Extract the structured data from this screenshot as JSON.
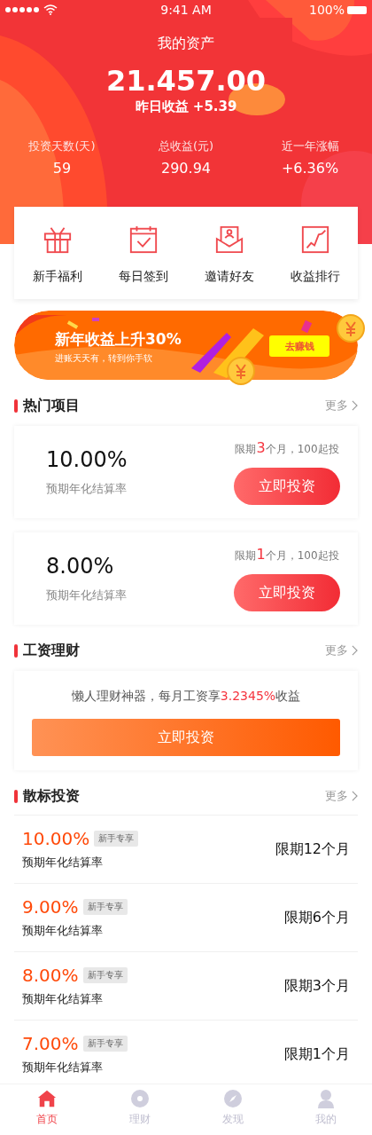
{
  "status_bar": {
    "time": "9:41 AM",
    "battery": "100%"
  },
  "header": {
    "title": "我的资产",
    "amount": "21.457.00",
    "yesterday": "昨日收益 +5.39",
    "stats": [
      {
        "label": "投资天数(天)",
        "value": "59"
      },
      {
        "label": "总收益(元)",
        "value": "290.94"
      },
      {
        "label": "近一年涨幅",
        "value": "+6.36%"
      }
    ]
  },
  "shortcuts": [
    {
      "kind": "gift",
      "label": "新手福利"
    },
    {
      "kind": "calendar",
      "label": "每日签到"
    },
    {
      "kind": "invite",
      "label": "邀请好友"
    },
    {
      "kind": "chart",
      "label": "收益排行"
    }
  ],
  "banner": {
    "title": "新年收益上升30%",
    "subtitle": "进账天天有，转到你手软",
    "button": "去赚钱"
  },
  "hot": {
    "title": "热门项目",
    "more": "更多",
    "items": [
      {
        "rate": "10.00%",
        "rate_label": "预期年化结算率",
        "term": [
          "限期",
          "3",
          "个月，100起投"
        ],
        "button": "立即投资"
      },
      {
        "rate": "8.00%",
        "rate_label": "预期年化结算率",
        "term": [
          "限期",
          "1",
          "个月，100起投"
        ],
        "button": "立即投资"
      }
    ]
  },
  "salary": {
    "title": "工资理财",
    "more": "更多",
    "text": [
      "懒人理财神器，每月工资享",
      "3.2345%",
      "收益"
    ],
    "button": "立即投资"
  },
  "loans": {
    "title": "散标投资",
    "more": "更多",
    "items": [
      {
        "rate": "10.00%",
        "tag": "新手专享",
        "rate_label": "预期年化结算率",
        "term": "限期12个月"
      },
      {
        "rate": "9.00%",
        "tag": "新手专享",
        "rate_label": "预期年化结算率",
        "term": "限期6个月"
      },
      {
        "rate": "8.00%",
        "tag": "新手专享",
        "rate_label": "预期年化结算率",
        "term": "限期3个月"
      },
      {
        "rate": "7.00%",
        "tag": "新手专享",
        "rate_label": "预期年化结算率",
        "term": "限期1个月"
      }
    ]
  },
  "tab_bar": [
    {
      "kind": "home",
      "label": "首页",
      "selected": true
    },
    {
      "kind": "finance",
      "label": "理财",
      "selected": false
    },
    {
      "kind": "discover",
      "label": "发现",
      "selected": false
    },
    {
      "kind": "profile",
      "label": "我的",
      "selected": false
    }
  ]
}
